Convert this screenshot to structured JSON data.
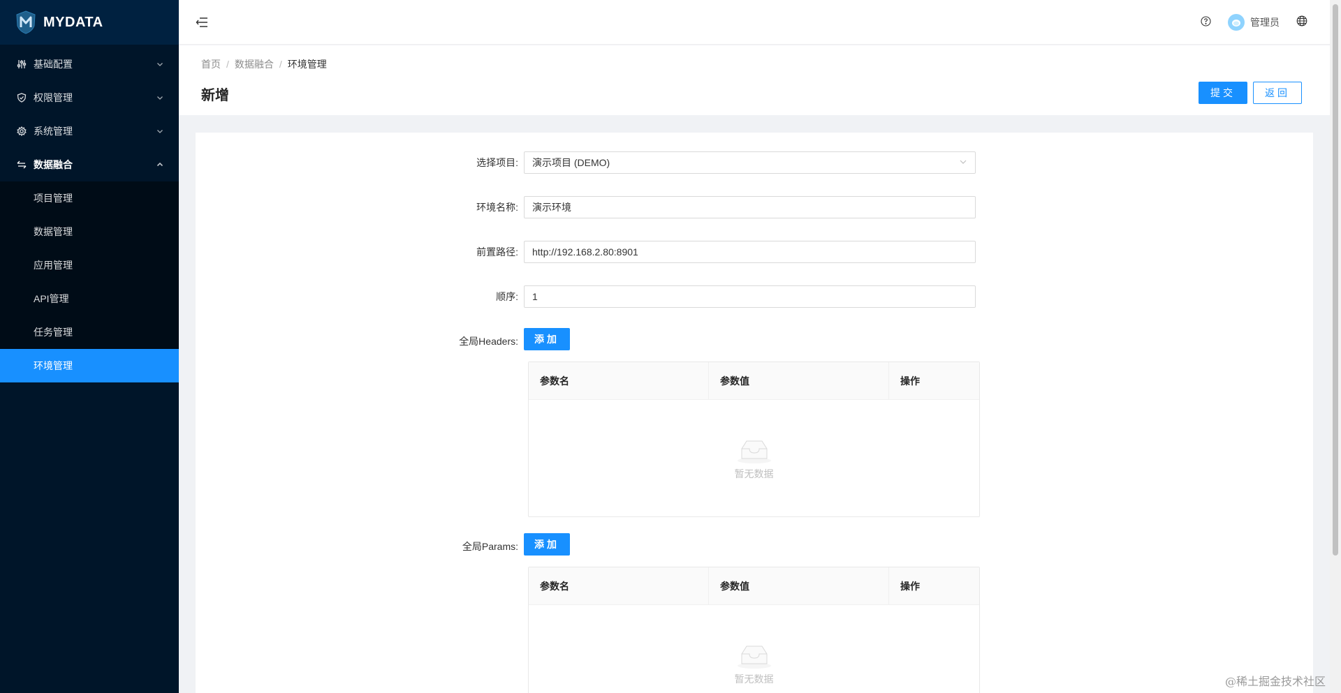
{
  "app": {
    "logo_text": "MYDATA"
  },
  "sidebar": {
    "items": [
      {
        "label": "基础配置",
        "icon": "sliders-icon",
        "expanded": false
      },
      {
        "label": "权限管理",
        "icon": "shield-icon",
        "expanded": false
      },
      {
        "label": "系统管理",
        "icon": "gear-icon",
        "expanded": false
      },
      {
        "label": "数据融合",
        "icon": "swap-icon",
        "expanded": true
      }
    ],
    "subitems": [
      {
        "label": "项目管理"
      },
      {
        "label": "数据管理"
      },
      {
        "label": "应用管理"
      },
      {
        "label": "API管理"
      },
      {
        "label": "任务管理"
      },
      {
        "label": "环境管理",
        "active": true
      }
    ]
  },
  "header": {
    "user_name": "管理员"
  },
  "breadcrumb": [
    "首页",
    "数据融合",
    "环境管理"
  ],
  "page": {
    "title": "新增",
    "submit_label": "提交",
    "back_label": "返回"
  },
  "form": {
    "project": {
      "label": "选择项目:",
      "value": "演示项目 (DEMO)"
    },
    "env_name": {
      "label": "环境名称:",
      "value": "演示环境"
    },
    "base_path": {
      "label": "前置路径:",
      "value": "http://192.168.2.80:8901"
    },
    "order": {
      "label": "顺序:",
      "value": "1"
    },
    "headers": {
      "label": "全局Headers:",
      "add_label": "添加"
    },
    "params": {
      "label": "全局Params:",
      "add_label": "添加"
    }
  },
  "table": {
    "columns": [
      "参数名",
      "参数值",
      "操作"
    ],
    "empty_text": "暂无数据"
  },
  "watermark": "@稀土掘金技术社区",
  "colors": {
    "primary": "#1890ff",
    "sidebar_bg": "#001529",
    "submenu_bg": "#000c17"
  }
}
